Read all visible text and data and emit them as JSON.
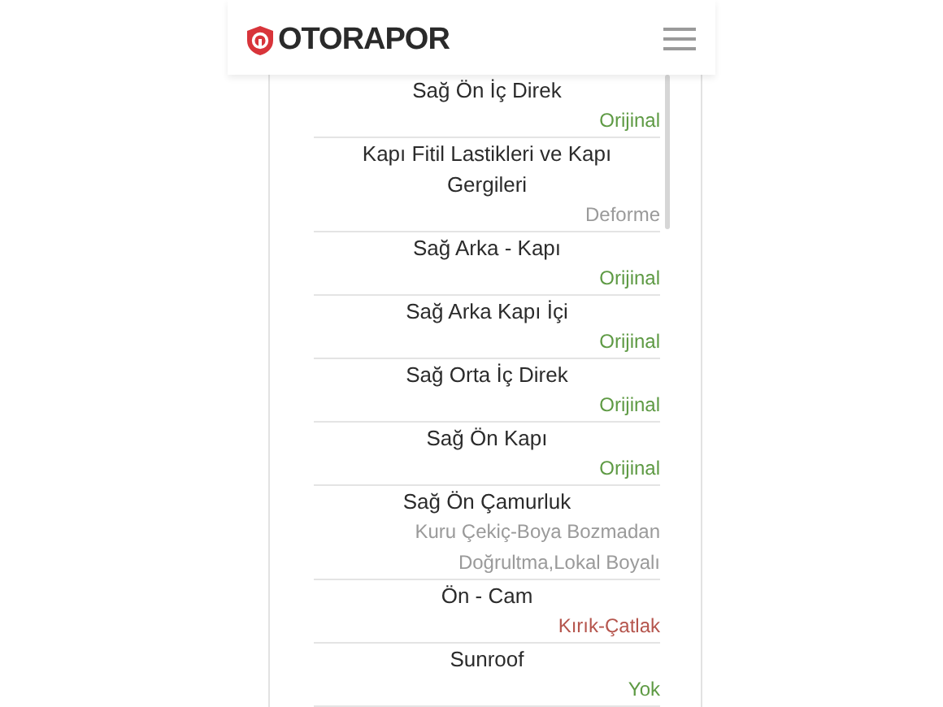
{
  "header": {
    "logo_text": "OTORAPOR"
  },
  "parts": [
    {
      "name": "Sağ Ön İç Direk",
      "status": "Orijinal",
      "color": "#5e9a44"
    },
    {
      "name": "Kapı Fitil Lastikleri ve Kapı Gergileri",
      "status": "Deforme",
      "color": "#9a9a9a"
    },
    {
      "name": "Sağ Arka - Kapı",
      "status": "Orijinal",
      "color": "#5e9a44"
    },
    {
      "name": "Sağ Arka Kapı İçi",
      "status": "Orijinal",
      "color": "#5e9a44"
    },
    {
      "name": "Sağ Orta İç Direk",
      "status": "Orijinal",
      "color": "#5e9a44"
    },
    {
      "name": "Sağ Ön Kapı",
      "status": "Orijinal",
      "color": "#5e9a44"
    },
    {
      "name": "Sağ Ön Çamurluk",
      "status": "Kuru Çekiç-Boya Bozmadan Doğrultma,Lokal Boyalı",
      "color": "#9a9a9a"
    },
    {
      "name": "Ön - Cam",
      "status": "Kırık-Çatlak",
      "color": "#b5554d"
    },
    {
      "name": "Sunroof",
      "status": "Yok",
      "color": "#5e9a44"
    }
  ]
}
